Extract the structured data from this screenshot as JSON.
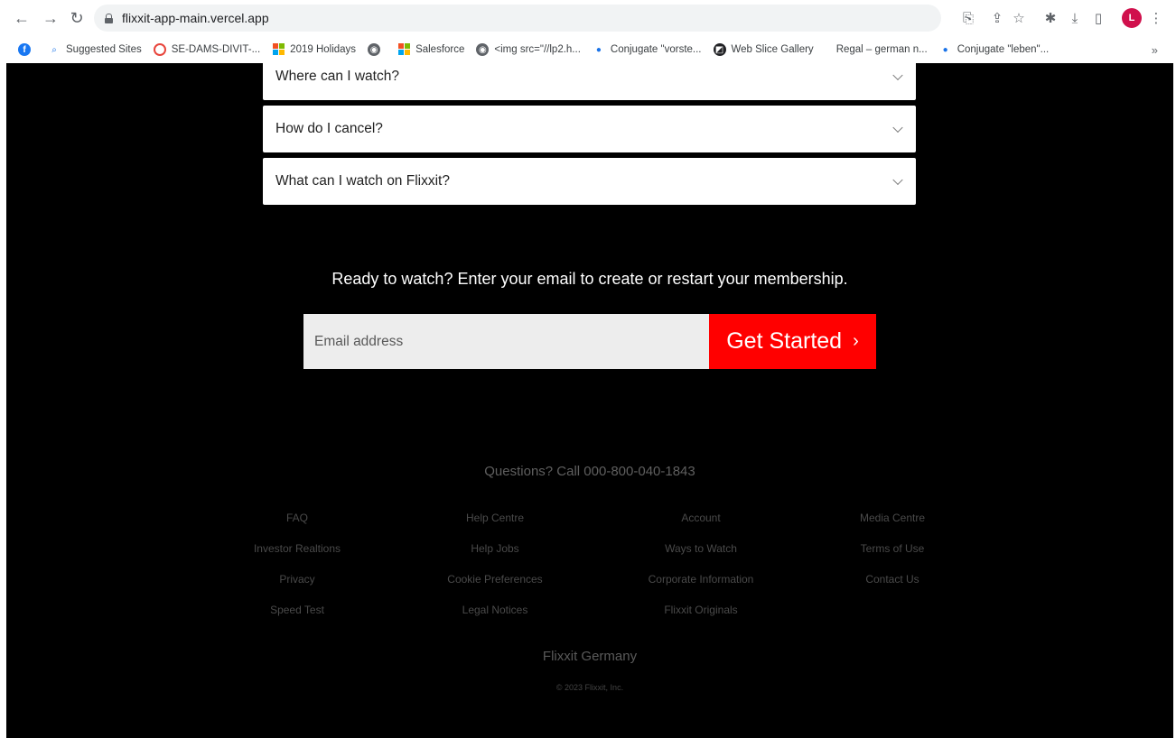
{
  "browser": {
    "url": "flixxit-app-main.vercel.app",
    "avatar_letter": "L",
    "bookmarks": [
      {
        "label": "",
        "icon": "facebook-icon"
      },
      {
        "label": "Suggested Sites",
        "icon": "search-icon"
      },
      {
        "label": "SE-DAMS-DIVIT-...",
        "icon": "target-icon"
      },
      {
        "label": "2019 Holidays",
        "icon": "microsoft-icon"
      },
      {
        "label": "",
        "icon": "globe-icon"
      },
      {
        "label": "Salesforce",
        "icon": "microsoft-icon"
      },
      {
        "label": "<img src=\"//lp2.h...",
        "icon": "globe-icon"
      },
      {
        "label": "Conjugate \"vorste...",
        "icon": "pin-icon"
      },
      {
        "label": "Web Slice Gallery",
        "icon": "web-slice-icon"
      },
      {
        "label": "Regal – german n...",
        "icon": ""
      },
      {
        "label": "Conjugate \"leben\"...",
        "icon": "pin-icon"
      }
    ],
    "more_bookmarks": "»"
  },
  "faq": {
    "items": [
      {
        "question": "Where can I watch?"
      },
      {
        "question": "How do I cancel?"
      },
      {
        "question": "What can I watch on Flixxit?"
      }
    ]
  },
  "cta": {
    "text": "Ready to watch? Enter your email to create or restart your membership.",
    "email_placeholder": "Email address",
    "button_label": "Get Started",
    "button_arrow": "›",
    "button_color": "#ff0000"
  },
  "footer": {
    "questions": "Questions? Call 000-800-040-1843",
    "columns": [
      [
        "FAQ",
        "Investor Realtions",
        "Privacy",
        "Speed Test"
      ],
      [
        "Help Centre",
        "Help Jobs",
        "Cookie Preferences",
        "Legal Notices"
      ],
      [
        "Account",
        "Ways to Watch",
        "Corporate Information",
        "Flixxit Originals"
      ],
      [
        "Media Centre",
        "Terms of Use",
        "Contact Us"
      ]
    ],
    "brand": "Flixxit Germany",
    "copyright": "© 2023 Flixxit, Inc."
  }
}
